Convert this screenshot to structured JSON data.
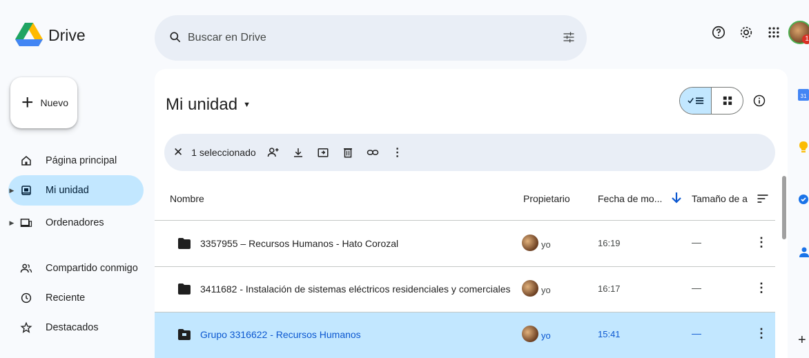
{
  "app": {
    "name": "Drive"
  },
  "search": {
    "placeholder": "Buscar en Drive"
  },
  "sidebar": {
    "new_label": "Nuevo",
    "items": [
      {
        "label": "Página principal",
        "icon": "home-icon"
      },
      {
        "label": "Mi unidad",
        "icon": "drive-icon",
        "active": true
      },
      {
        "label": "Ordenadores",
        "icon": "computer-icon"
      },
      {
        "label": "Compartido conmigo",
        "icon": "people-icon"
      },
      {
        "label": "Reciente",
        "icon": "clock-icon"
      },
      {
        "label": "Destacados",
        "icon": "star-icon"
      }
    ]
  },
  "main": {
    "title": "Mi unidad",
    "selection": {
      "count_label": "1 seleccionado"
    },
    "columns": {
      "name": "Nombre",
      "owner": "Propietario",
      "modified": "Fecha de mo...",
      "size": "Tamaño de a"
    },
    "rows": [
      {
        "name": "3357955 – Recursos Humanos - Hato Corozal",
        "owner": "yo",
        "modified": "16:19",
        "size": "—",
        "type": "folder",
        "selected": false
      },
      {
        "name": "3411682 - Instalación de sistemas eléctricos residenciales y comerciales",
        "owner": "yo",
        "modified": "16:17",
        "size": "—",
        "type": "folder",
        "selected": false
      },
      {
        "name": "Grupo 3316622 - Recursos Humanos",
        "owner": "yo",
        "modified": "15:41",
        "size": "—",
        "type": "shared-folder",
        "selected": true
      }
    ]
  },
  "account": {
    "notification_badge": "1"
  },
  "colors": {
    "accent": "#0b57d0",
    "selected_bg": "#c2e7ff",
    "surface": "#ffffff",
    "page_bg": "#f8fafd",
    "search_bg": "#e9eef6"
  }
}
